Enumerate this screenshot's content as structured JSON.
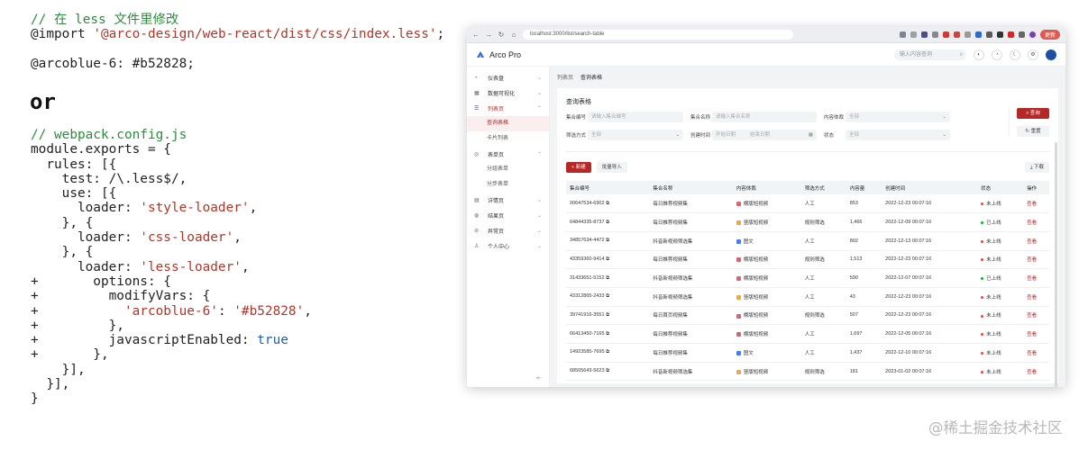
{
  "code_top": {
    "comment": "// 在 less 文件里修改",
    "import_kw": "@import",
    "import_path": "'@arco-design/web-react/dist/css/index.less'",
    "semicolon": ";",
    "var_name": "@arcoblue-6",
    "var_value": ": #b52828;"
  },
  "or_label": "or",
  "code_bottom": {
    "comment": "// webpack.config.js",
    "line1": "module.exports = {",
    "line2": "  rules: [{",
    "line3": "    test: /\\.less$/,",
    "line4": "    use: [{",
    "line5a": "      loader: ",
    "line5b": "'style-loader'",
    "line5c": ",",
    "line6": "    }, {",
    "line7a": "      loader: ",
    "line7b": "'css-loader'",
    "line7c": ",",
    "line8": "    }, {",
    "line9a": "      loader: ",
    "line9b": "'less-loader'",
    "line9c": ",",
    "line10": "+       options: {",
    "line11": "+         modifyVars: {",
    "line12a": "+           ",
    "line12b": "'arcoblue-6'",
    "line12c": ": ",
    "line12d": "'#b52828'",
    "line12e": ",",
    "line13": "+         },",
    "line14a": "+         javascriptEnabled: ",
    "line14b": "true",
    "line15": "+       },",
    "line16": "    }],",
    "line17": "  }],",
    "line18": "}"
  },
  "browser": {
    "url": "localhost:3000/list/search-table",
    "update_label": "更新",
    "app_title": "Arco Pro",
    "header_search_placeholder": "输入内容查询",
    "breadcrumb": [
      "列表页",
      "查询表格"
    ],
    "menu": [
      {
        "icon": "dashboard-icon",
        "glyph": "◔",
        "label": "仪表盘"
      },
      {
        "icon": "visualization-icon",
        "glyph": "▦",
        "label": "数据可视化"
      },
      {
        "icon": "list-icon",
        "glyph": "☰",
        "label": "列表页",
        "open": true
      },
      {
        "icon": "form-icon",
        "glyph": "◎",
        "label": "表单页"
      },
      {
        "icon": "profile-icon",
        "glyph": "▤",
        "label": "详情页"
      },
      {
        "icon": "result-icon",
        "glyph": "◍",
        "label": "结果页"
      },
      {
        "icon": "exception-icon",
        "glyph": "⊘",
        "label": "异常页"
      },
      {
        "icon": "user-icon",
        "glyph": "♙",
        "label": "个人中心"
      }
    ],
    "list_sub": [
      "查询表格",
      "卡片列表"
    ],
    "form_sub": [
      "分组表单",
      "分步表单"
    ],
    "card_title": "查询表格",
    "filters": {
      "id_label": "集合编号",
      "id_ph": "请输入集合编号",
      "name_label": "集合名称",
      "name_ph": "请输入集合名称",
      "type_label": "内容体裁",
      "type_val": "全部",
      "method_label": "筛选方式",
      "method_val": "全部",
      "time_label": "创建时间",
      "time_start": "开始日期",
      "time_end": "结束日期",
      "status_label": "状态",
      "status_val": "全部"
    },
    "search_btn": "查询",
    "reset_btn": "重置",
    "new_btn": "+ 新建",
    "batch_btn": "批量导入",
    "download_btn": "下载",
    "columns": [
      "集合编号",
      "集合名称",
      "内容体裁",
      "筛选方式",
      "内容量",
      "创建时间",
      "状态",
      "操作"
    ],
    "rows": [
      {
        "id": "00647534-6902",
        "name": "每日推荐视频集",
        "type": "横版短视频",
        "tc": "#e4606d",
        "method": "人工",
        "count": "853",
        "time": "2022-12-23 00:07:16",
        "status": "未上线",
        "sc": "#f53f3f",
        "op": "查看"
      },
      {
        "id": "64844335-8737",
        "name": "每日推荐视频集",
        "type": "竖版短视频",
        "tc": "#f7a53c",
        "method": "规则筛选",
        "count": "1,466",
        "time": "2022-12-09 00:07:16",
        "status": "已上线",
        "sc": "#00b42a",
        "op": "查看"
      },
      {
        "id": "34857634-4472",
        "name": "抖音新视频筛选集",
        "type": "图文",
        "tc": "#3c7eff",
        "method": "人工",
        "count": "802",
        "time": "2022-12-13 00:07:16",
        "status": "未上线",
        "sc": "#f53f3f",
        "op": "查看"
      },
      {
        "id": "43359360-9414",
        "name": "每日推荐视频集",
        "type": "横版短视频",
        "tc": "#e4606d",
        "method": "规则筛选",
        "count": "1,513",
        "time": "2022-12-23 00:07:16",
        "status": "未上线",
        "sc": "#f53f3f",
        "op": "查看"
      },
      {
        "id": "31433651-5152",
        "name": "抖音新视频筛选集",
        "type": "横版短视频",
        "tc": "#e4606d",
        "method": "人工",
        "count": "590",
        "time": "2022-12-07 00:07:16",
        "status": "已上线",
        "sc": "#00b42a",
        "op": "查看"
      },
      {
        "id": "43312865-2433",
        "name": "抖音新视频筛选集",
        "type": "竖版短视频",
        "tc": "#f7a53c",
        "method": "人工",
        "count": "43",
        "time": "2022-12-23 00:07:16",
        "status": "未上线",
        "sc": "#f53f3f",
        "op": "查看"
      },
      {
        "id": "39741916-3551",
        "name": "每日首页视频集",
        "type": "横版短视频",
        "tc": "#e4606d",
        "method": "规则筛选",
        "count": "507",
        "time": "2022-12-23 00:07:16",
        "status": "未上线",
        "sc": "#f53f3f",
        "op": "查看"
      },
      {
        "id": "66413450-7165",
        "name": "每日推荐视频集",
        "type": "横版短视频",
        "tc": "#e4606d",
        "method": "人工",
        "count": "1,697",
        "time": "2022-12-05 00:07:16",
        "status": "未上线",
        "sc": "#f53f3f",
        "op": "查看"
      },
      {
        "id": "14923585-7695",
        "name": "每日推荐视频集",
        "type": "图文",
        "tc": "#3c7eff",
        "method": "人工",
        "count": "1,437",
        "time": "2022-12-10 00:07:16",
        "status": "未上线",
        "sc": "#f53f3f",
        "op": "查看"
      },
      {
        "id": "68505643-5623",
        "name": "抖音新视频筛选集",
        "type": "竖版短视频",
        "tc": "#f7a53c",
        "method": "规则筛选",
        "count": "181",
        "time": "2023-01-02 00:07:16",
        "status": "未上线",
        "sc": "#f53f3f",
        "op": "查看"
      }
    ]
  },
  "watermark": "@稀土掘金技术社区",
  "colors": {
    "brand": "#b52828",
    "comment": "#2e8b3e",
    "string": "#b0362a",
    "boolean": "#1f5fb0"
  }
}
